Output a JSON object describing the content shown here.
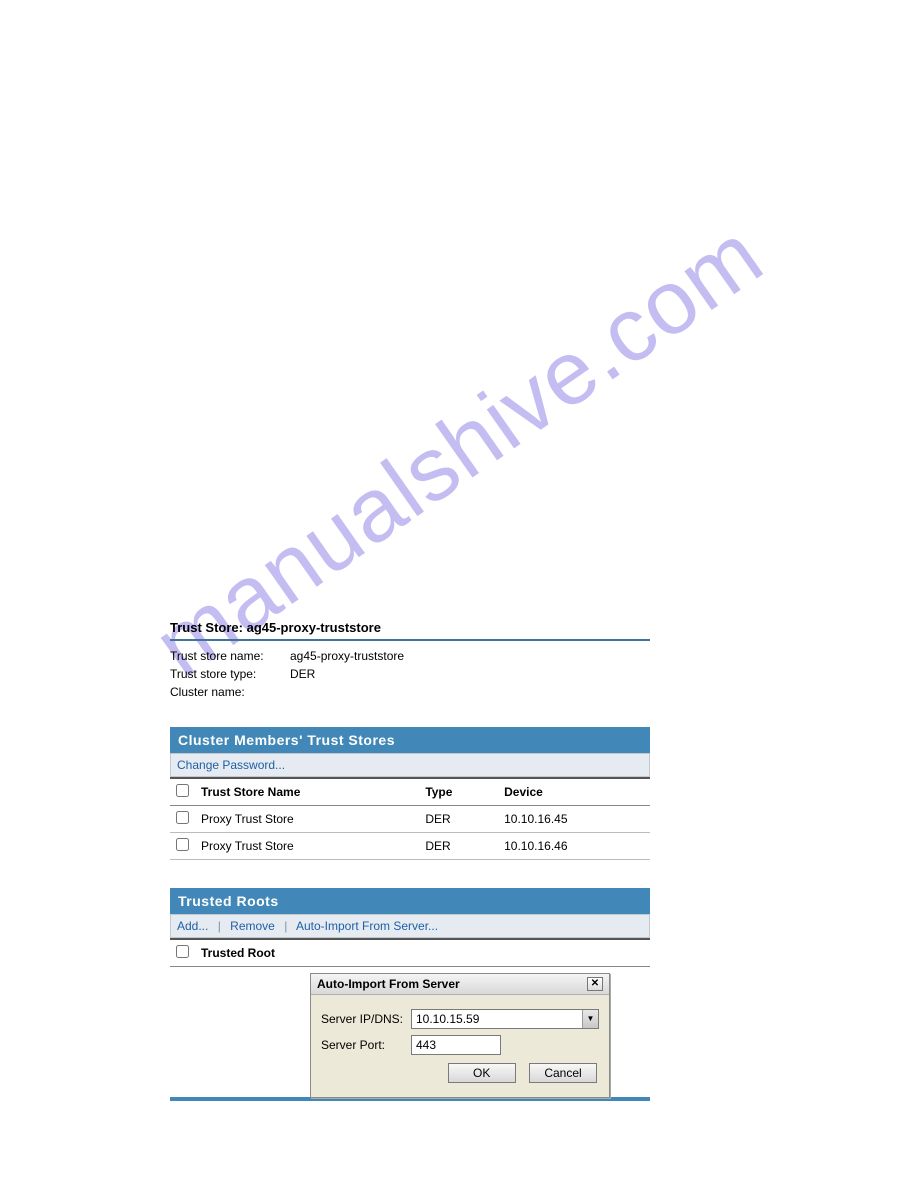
{
  "watermark": "manualshive.com",
  "trustStore": {
    "titlePrefix": "Trust Store:",
    "titleName": "ag45-proxy-truststore",
    "fields": {
      "nameLabel": "Trust store name:",
      "nameValue": "ag45-proxy-truststore",
      "typeLabel": "Trust store type:",
      "typeValue": "DER",
      "clusterLabel": "Cluster name:",
      "clusterValue": ""
    }
  },
  "clusterMembers": {
    "header": "Cluster Members' Trust Stores",
    "changePassword": "Change Password...",
    "columns": {
      "name": "Trust Store Name",
      "type": "Type",
      "device": "Device"
    },
    "rows": [
      {
        "name": "Proxy Trust Store",
        "type": "DER",
        "device": "10.10.16.45"
      },
      {
        "name": "Proxy Trust Store",
        "type": "DER",
        "device": "10.10.16.46"
      }
    ]
  },
  "trustedRoots": {
    "header": "Trusted Roots",
    "actions": {
      "add": "Add...",
      "remove": "Remove",
      "autoImport": "Auto-Import From Server..."
    },
    "column": "Trusted Root"
  },
  "dialog": {
    "title": "Auto-Import From Server",
    "ipLabel": "Server IP/DNS:",
    "ipValue": "10.10.15.59",
    "portLabel": "Server Port:",
    "portValue": "443",
    "ok": "OK",
    "cancel": "Cancel"
  }
}
